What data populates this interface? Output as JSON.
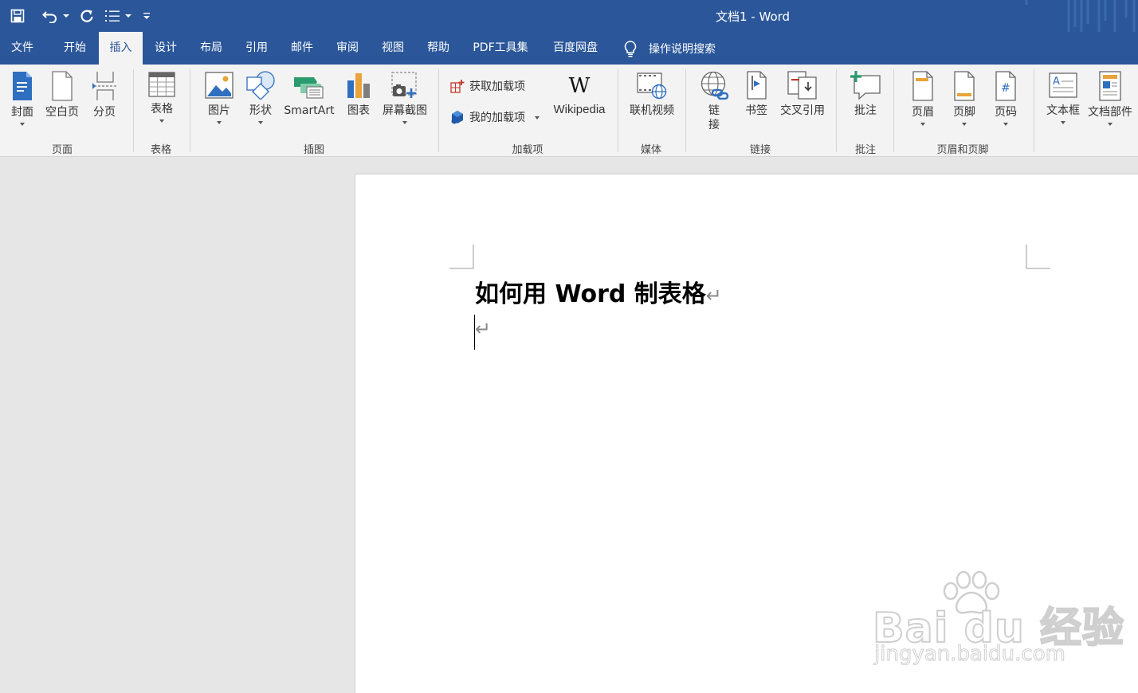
{
  "window": {
    "title": "文档1  -  Word"
  },
  "qat": {
    "icons": [
      "save-icon",
      "undo-icon",
      "redo-icon",
      "list-icon",
      "customize-icon"
    ]
  },
  "tabs": [
    "文件",
    "开始",
    "插入",
    "设计",
    "布局",
    "引用",
    "邮件",
    "审阅",
    "视图",
    "帮助",
    "PDF工具集",
    "百度网盘"
  ],
  "active_tab": "插入",
  "tell_me": {
    "label": "操作说明搜索"
  },
  "ribbon": {
    "groups": {
      "pages": "页面",
      "tables": "表格",
      "illustrations": "插图",
      "addins": "加载项",
      "media": "媒体",
      "links": "链接",
      "comments": "批注",
      "header_footer": "页眉和页脚"
    },
    "buttons": {
      "cover": "封面",
      "blank_page": "空白页",
      "page_break": "分页",
      "table": "表格",
      "picture": "图片",
      "shapes": "形状",
      "smartart": "SmartArt",
      "chart": "图表",
      "screenshot": "屏幕截图",
      "get_addins": "获取加载项",
      "my_addins": "我的加载项",
      "wikipedia": "Wikipedia",
      "online_video": "联机视频",
      "link_1": "链",
      "link_2": "接",
      "bookmark": "书签",
      "cross_ref": "交叉引用",
      "comment": "批注",
      "header": "页眉",
      "footer": "页脚",
      "page_number": "页码",
      "textbox": "文本框",
      "quick_parts": "文档部件"
    },
    "wikipedia_glyph": "W"
  },
  "document": {
    "heading": "如何用 Word 制表格",
    "para_mark": "↵"
  },
  "watermark": {
    "main": "Bai  du 经验",
    "sub": "jingyan.baidu.com"
  },
  "colors": {
    "title_bar": "#2b579a",
    "ribbon_bg": "#f3f3f3",
    "canvas_bg": "#e6e6e6"
  }
}
